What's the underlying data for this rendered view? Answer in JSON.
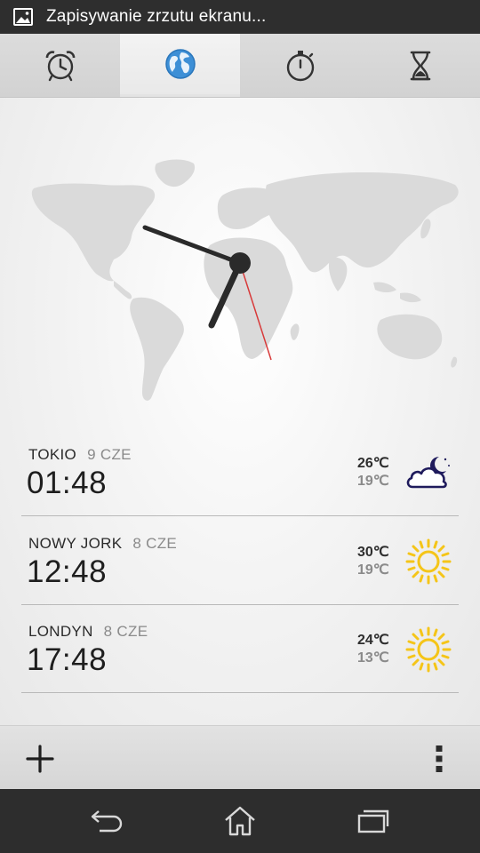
{
  "status_bar": {
    "notification_icon": "image-icon",
    "text": "Zapisywanie zrzutu ekranu..."
  },
  "tabs": [
    {
      "icon": "alarm-clock-icon",
      "active": false
    },
    {
      "icon": "globe-icon",
      "active": true
    },
    {
      "icon": "stopwatch-icon",
      "active": false
    },
    {
      "icon": "hourglass-icon",
      "active": false
    }
  ],
  "colors": {
    "accent_blue": "#3d8fd6",
    "second_hand": "#d83a3a",
    "sun_yellow": "#f5c518",
    "moon_navy": "#1f1b5c"
  },
  "cities": [
    {
      "name": "TOKIO",
      "date": "9 CZE",
      "time": "01:48",
      "temp_high": "26℃",
      "temp_low": "19℃",
      "weather_icon": "night-partly-cloudy-icon"
    },
    {
      "name": "NOWY JORK",
      "date": "8 CZE",
      "time": "12:48",
      "temp_high": "30℃",
      "temp_low": "19℃",
      "weather_icon": "sunny-icon"
    },
    {
      "name": "LONDYN",
      "date": "8 CZE",
      "time": "17:48",
      "temp_high": "24℃",
      "temp_low": "13℃",
      "weather_icon": "sunny-icon"
    }
  ],
  "action_bar": {
    "add_icon": "plus-icon",
    "menu_icon": "overflow-menu-icon"
  },
  "nav_bar": {
    "back_icon": "back-icon",
    "home_icon": "home-icon",
    "recents_icon": "recent-apps-icon"
  }
}
